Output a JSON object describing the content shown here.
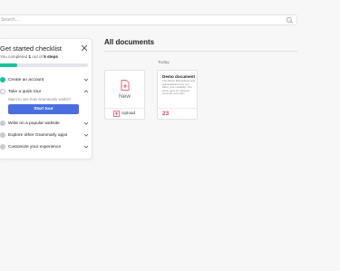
{
  "search": {
    "placeholder": "Search..."
  },
  "checklist": {
    "title": "Get started checklist",
    "subtitle_prefix": "You completed ",
    "completed_count": "1",
    "subtitle_middle": " out of ",
    "total_label": "5 steps",
    "progress_fraction": 0.2,
    "steps": [
      {
        "label": "Create an account",
        "state": "done"
      },
      {
        "label": "Take a quick tour",
        "state": "open",
        "description": "Want to see how Grammarly works?",
        "button_label": "Start tour"
      },
      {
        "label": "Write on a popular website",
        "state": "todo"
      },
      {
        "label": "Explore other Grammarly apps",
        "state": "todo"
      },
      {
        "label": "Customize your experience",
        "state": "todo"
      }
    ]
  },
  "documents": {
    "title": "All documents",
    "section_label": "Today",
    "new_card": {
      "label": "New",
      "upload_label": "Upload"
    },
    "demo_doc": {
      "title": "Demo document",
      "preview": "The basics Misspellings and grammatical errors can effect your credibility. The same goes for misused commas, and other",
      "count": "23"
    }
  },
  "colors": {
    "accent_green": "#15c39a",
    "button_blue": "#4a6ee0",
    "count_red": "#e8414e"
  }
}
